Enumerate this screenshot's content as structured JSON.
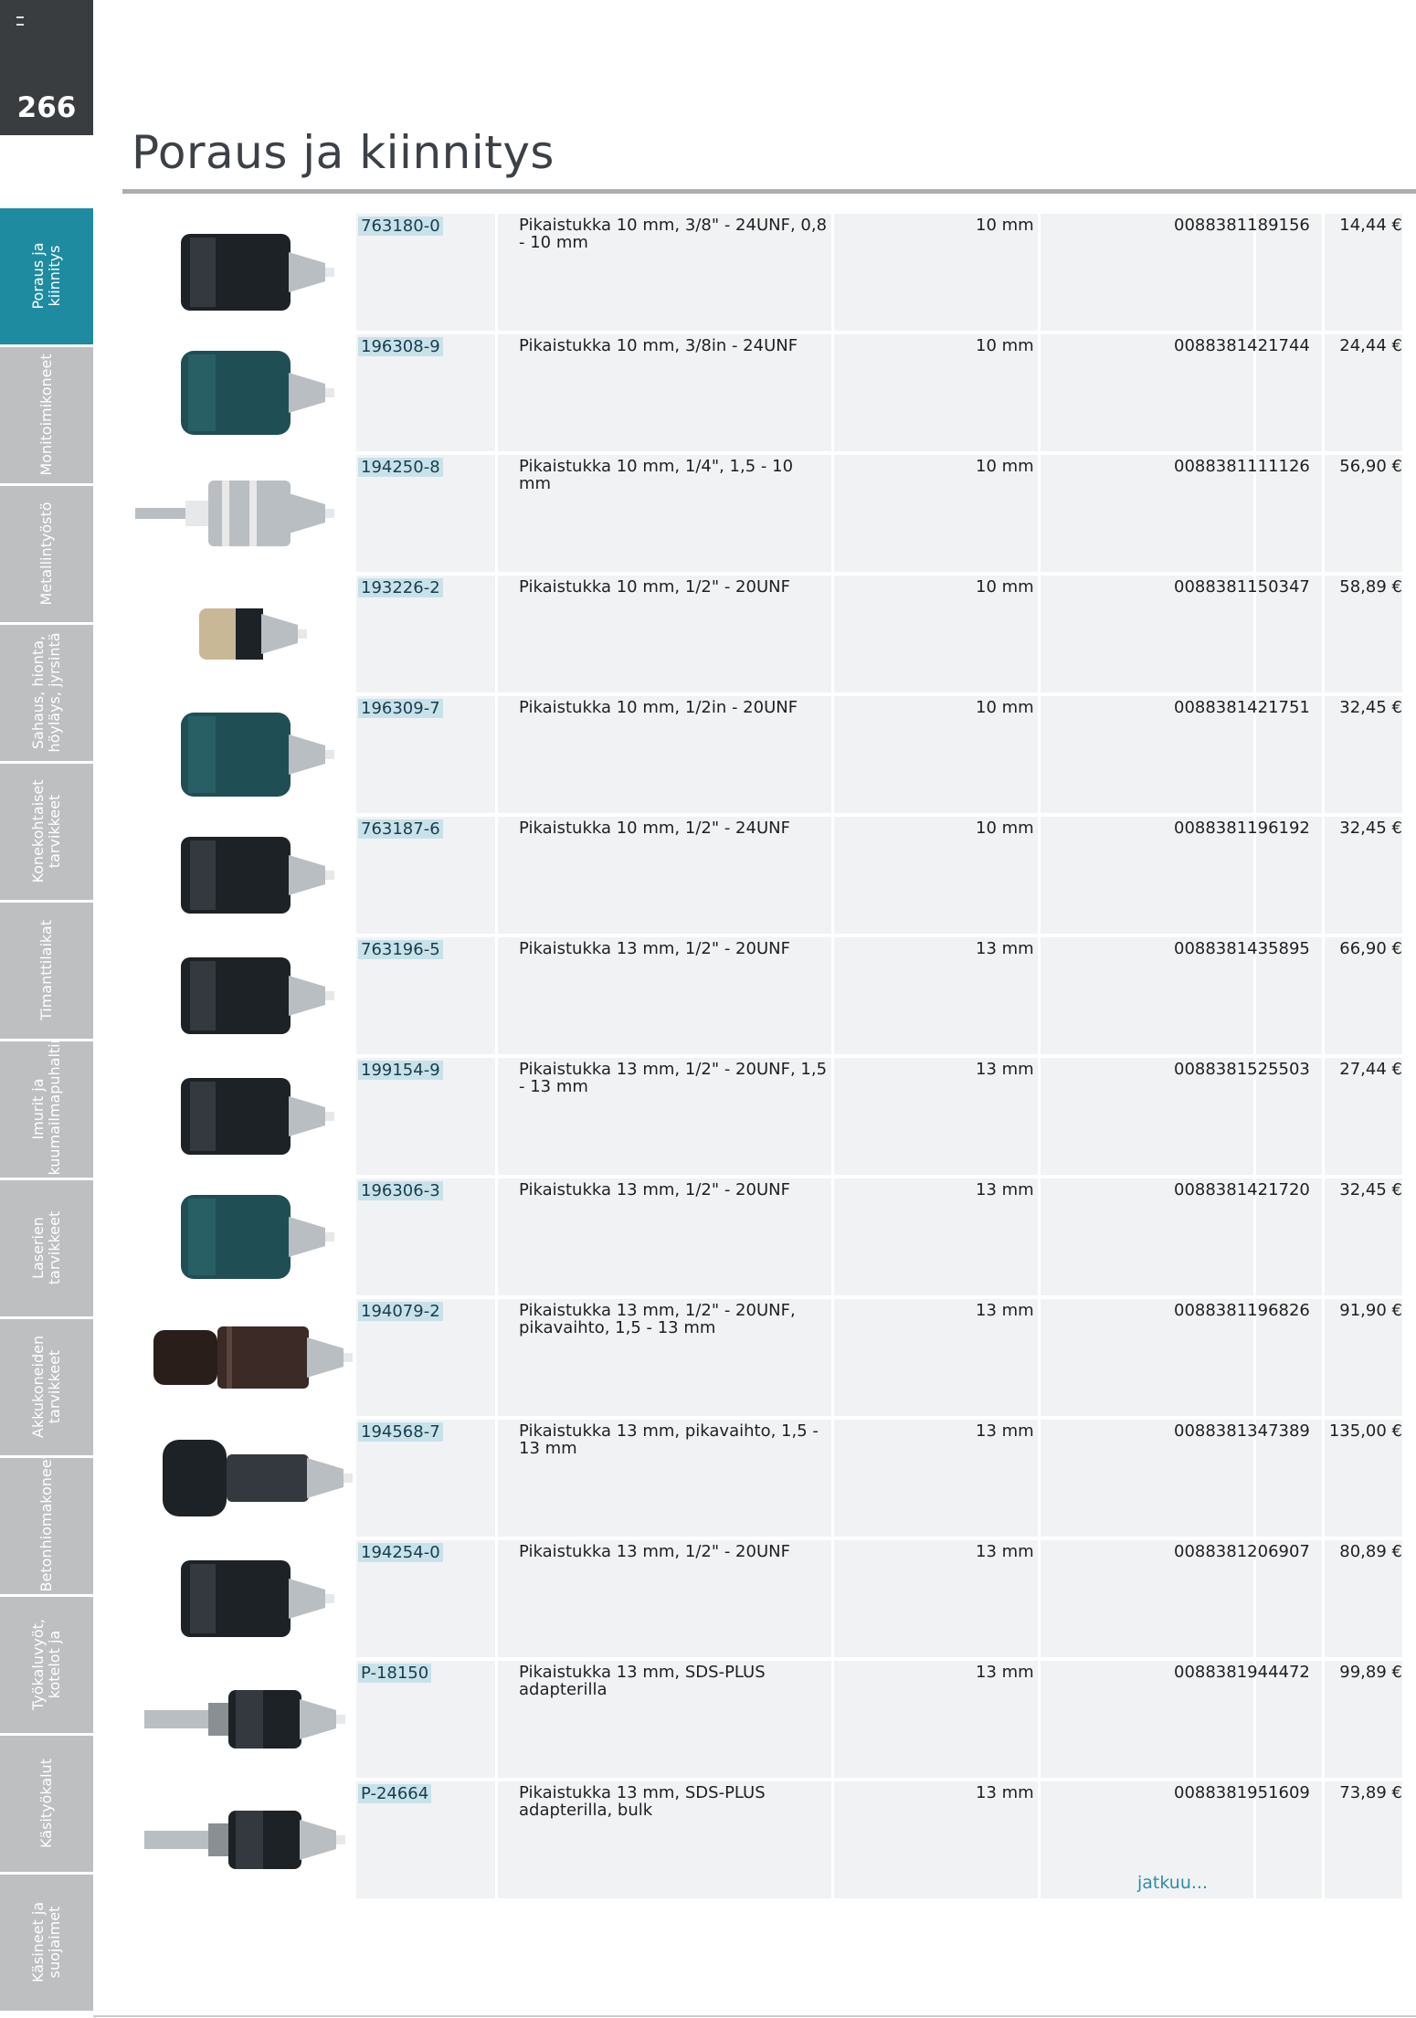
{
  "page": {
    "number": "266",
    "title": "Poraus ja kiinnitys",
    "more_link": "jatkuu..."
  },
  "sidebar": {
    "tabs": [
      {
        "label": "Poraus ja kiinnitys",
        "active": true
      },
      {
        "label": "Monitoimikoneet",
        "active": false
      },
      {
        "label": "Metallintyöstö",
        "active": false
      },
      {
        "label": "Sahaus, hionta, höyläys, jyrsintä",
        "active": false
      },
      {
        "label": "Konekohtaiset tarvikkeet",
        "active": false
      },
      {
        "label": "Timanttilaikat",
        "active": false
      },
      {
        "label": "Imurit ja kuumailmapuhaltimet",
        "active": false
      },
      {
        "label": "Laserien tarvikkeet",
        "active": false
      },
      {
        "label": "Akkukoneiden tarvikkeet",
        "active": false
      },
      {
        "label": "Betonhiomakoneet",
        "active": false
      },
      {
        "label": "Työkaluvyöt, kotelot ja",
        "active": false
      },
      {
        "label": "Käsityökalut",
        "active": false
      },
      {
        "label": "Käsineet ja suojaimet",
        "active": false
      }
    ]
  },
  "products": [
    {
      "sku": "763180-0",
      "description": "Pikaistukka 10 mm, 3/8\" - 24UNF, 0,8 - 10 mm",
      "size": "10 mm",
      "ean": "0088381189156",
      "price": "14,44 €",
      "image": "keyless-chuck-black"
    },
    {
      "sku": "196308-9",
      "description": "Pikaistukka 10 mm, 3/8in - 24UNF",
      "size": "10 mm",
      "ean": "0088381421744",
      "price": "24,44 €",
      "image": "keyless-chuck-green"
    },
    {
      "sku": "194250-8",
      "description": "Pikaistukka 10 mm, 1/4\", 1,5 - 10 mm",
      "size": "10 mm",
      "ean": "0088381111126",
      "price": "56,90 €",
      "image": "keyed-chuck-hex-shank"
    },
    {
      "sku": "193226-2",
      "description": "Pikaistukka 10 mm, 1/2\" - 20UNF",
      "size": "10 mm",
      "ean": "0088381150347",
      "price": "58,89 €",
      "image": "small-metal-chuck"
    },
    {
      "sku": "196309-7",
      "description": "Pikaistukka 10 mm, 1/2in - 20UNF",
      "size": "10 mm",
      "ean": "0088381421751",
      "price": "32,45 €",
      "image": "keyless-chuck-green"
    },
    {
      "sku": "763187-6",
      "description": "Pikaistukka 10 mm, 1/2\" - 24UNF",
      "size": "10 mm",
      "ean": "0088381196192",
      "price": "32,45 €",
      "image": "keyless-chuck-black"
    },
    {
      "sku": "763196-5",
      "description": "Pikaistukka 13 mm, 1/2\" - 20UNF",
      "size": "13 mm",
      "ean": "0088381435895",
      "price": "66,90 €",
      "image": "keyless-chuck-black"
    },
    {
      "sku": "199154-9",
      "description": "Pikaistukka 13 mm, 1/2\" - 20UNF, 1,5 - 13 mm",
      "size": "13 mm",
      "ean": "0088381525503",
      "price": "27,44 €",
      "image": "keyless-chuck-black"
    },
    {
      "sku": "196306-3",
      "description": "Pikaistukka 13 mm, 1/2\" - 20UNF",
      "size": "13 mm",
      "ean": "0088381421720",
      "price": "32,45 €",
      "image": "keyless-chuck-green"
    },
    {
      "sku": "194079-2",
      "description": "Pikaistukka 13 mm, 1/2\" - 20UNF, pikavaihto, 1,5 - 13 mm",
      "size": "13 mm",
      "ean": "0088381196826",
      "price": "91,90 €",
      "image": "quick-change-chuck"
    },
    {
      "sku": "194568-7",
      "description": "Pikaistukka 13 mm, pikavaihto, 1,5 - 13 mm",
      "size": "13 mm",
      "ean": "0088381347389",
      "price": "135,00 €",
      "image": "quick-change-chuck-adapter"
    },
    {
      "sku": "194254-0",
      "description": "Pikaistukka 13 mm, 1/2\" - 20UNF",
      "size": "13 mm",
      "ean": "0088381206907",
      "price": "80,89 €",
      "image": "keyless-chuck-black"
    },
    {
      "sku": "P-18150",
      "description": "Pikaistukka 13 mm, SDS-PLUS adapterilla",
      "size": "13 mm",
      "ean": "0088381944472",
      "price": "99,89 €",
      "image": "chuck-sds-adapter"
    },
    {
      "sku": "P-24664",
      "description": "Pikaistukka 13 mm, SDS-PLUS adapterilla, bulk",
      "size": "13 mm",
      "ean": "0088381951609",
      "price": "73,89 €",
      "image": "chuck-sds-adapter"
    }
  ]
}
